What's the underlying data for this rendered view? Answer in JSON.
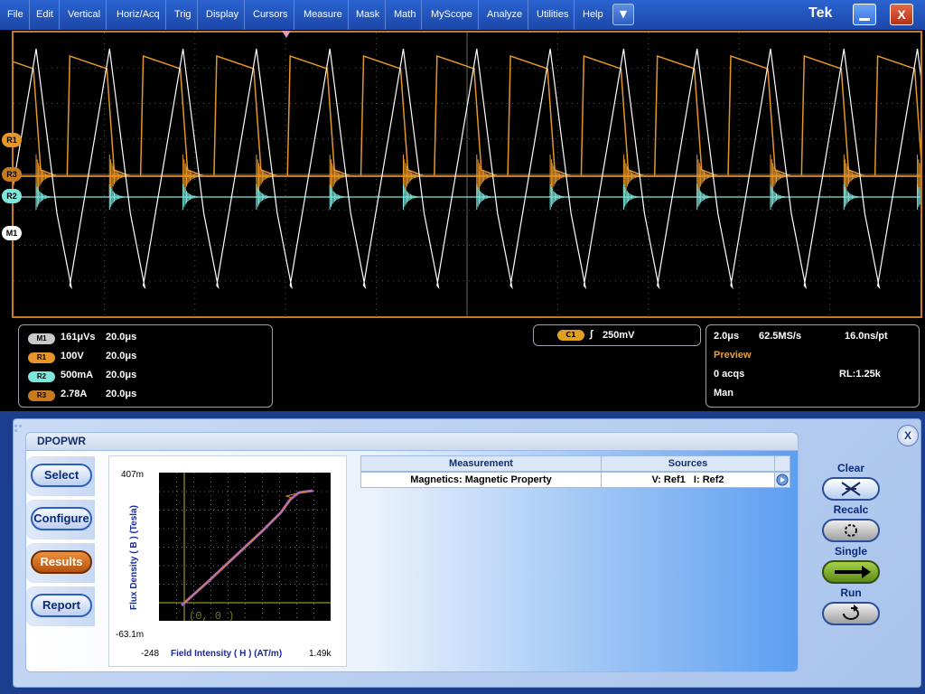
{
  "menu": {
    "items": [
      "File",
      "Edit",
      "Vertical",
      "Horiz/Acq",
      "Trig",
      "Display",
      "Cursors",
      "Measure",
      "Mask",
      "Math",
      "MyScope",
      "Analyze",
      "Utilities",
      "Help"
    ],
    "more_icon": "dropdown-arrow",
    "brand": "Tek",
    "minimize_label": "",
    "close_label": "X"
  },
  "waveform": {
    "markers": {
      "r1": "R1",
      "r3": "R3",
      "r2": "R2",
      "m1": "M1"
    },
    "colors": {
      "r1": "#e69628",
      "r3": "#c87a20",
      "r2": "#7ee6dc",
      "m1": "#ffffff"
    }
  },
  "status": {
    "refs": [
      {
        "badge": "M1",
        "scale": "161μVs",
        "time": "20.0μs"
      },
      {
        "badge": "R1",
        "scale": "100V",
        "time": "20.0μs"
      },
      {
        "badge": "R2",
        "scale": "500mA",
        "time": "20.0μs"
      },
      {
        "badge": "R3",
        "scale": "2.78A",
        "time": "20.0μs"
      }
    ],
    "trigger": {
      "source": "C1",
      "level": "250mV"
    },
    "acq": {
      "horiz_scale": "2.0μs",
      "sample_rate": "62.5MS/s",
      "resolution": "16.0ns/pt",
      "mode": "Preview",
      "acqs": "0 acqs",
      "record_length": "RL:1.25k",
      "trigger_mode": "Man"
    }
  },
  "app": {
    "title": "DPOPWR",
    "close_label": "X",
    "nav": [
      "Select",
      "Configure",
      "Results",
      "Report"
    ],
    "active_nav": "Results",
    "plot": {
      "y_max": "407m",
      "y_min": "-63.1m",
      "x_min": "-248",
      "x_max": "1.49k",
      "y_label": "Flux Density ( B ) (Tesla)",
      "x_label": "Field Intensity ( H ) (AT/m)",
      "origin_label": "(0, 0 )"
    },
    "table": {
      "headers": [
        "Measurement",
        "Sources"
      ],
      "rows": [
        {
          "measurement": "Magnetics: Magnetic Property",
          "sources": "V: Ref1   I: Ref2"
        }
      ]
    },
    "controls": {
      "clear": "Clear",
      "recalc": "Recalc",
      "single": "Single",
      "run": "Run"
    }
  }
}
